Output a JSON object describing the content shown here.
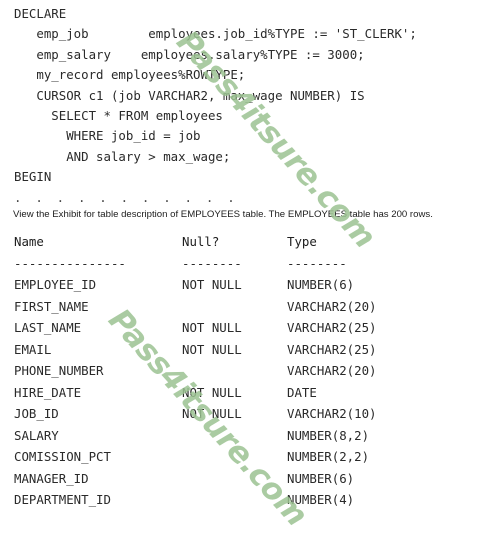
{
  "watermark": {
    "text": "Pass4itsure.com",
    "color": "#9cc392",
    "instances": [
      "top",
      "bottom"
    ]
  },
  "code_block": {
    "lines": [
      "DECLARE",
      "   emp_job        employees.job_id%TYPE := 'ST_CLERK';",
      "   emp_salary    employees.salary%TYPE := 3000;",
      "   my_record employees%ROWTYPE;",
      "   CURSOR c1 (job VARCHAR2, max_wage NUMBER) IS",
      "     SELECT * FROM employees",
      "       WHERE job_id = job",
      "       AND salary > max_wage;",
      "BEGIN",
      ". . . . . . . . . . ."
    ]
  },
  "exhibit_note": {
    "text": "View the Exhibit for table description of EMPLOYEES table. The EMPLOYEES table has 200 rows."
  },
  "description_table": {
    "headers": {
      "name": "Name",
      "null": "Null?",
      "type": "Type"
    },
    "rules": {
      "name": "---------------",
      "null": "--------",
      "type": "--------"
    },
    "rows": [
      {
        "name": "EMPLOYEE_ID",
        "null": "NOT NULL",
        "type": "NUMBER(6)"
      },
      {
        "name": "FIRST_NAME",
        "null": "",
        "type": "VARCHAR2(20)"
      },
      {
        "name": "LAST_NAME",
        "null": "NOT NULL",
        "type": "VARCHAR2(25)"
      },
      {
        "name": "EMAIL",
        "null": "NOT NULL",
        "type": "VARCHAR2(25)"
      },
      {
        "name": "PHONE_NUMBER",
        "null": "",
        "type": "VARCHAR2(20)"
      },
      {
        "name": "HIRE_DATE",
        "null": "NOT NULL",
        "type": "DATE"
      },
      {
        "name": "JOB_ID",
        "null": "NOT NULL",
        "type": "VARCHAR2(10)"
      },
      {
        "name": "SALARY",
        "null": "",
        "type": "NUMBER(8,2)"
      },
      {
        "name": "COMISSION_PCT",
        "null": "",
        "type": "NUMBER(2,2)"
      },
      {
        "name": "MANAGER_ID",
        "null": "",
        "type": "NUMBER(6)"
      },
      {
        "name": "DEPARTMENT_ID",
        "null": "",
        "type": "NUMBER(4)"
      }
    ]
  }
}
